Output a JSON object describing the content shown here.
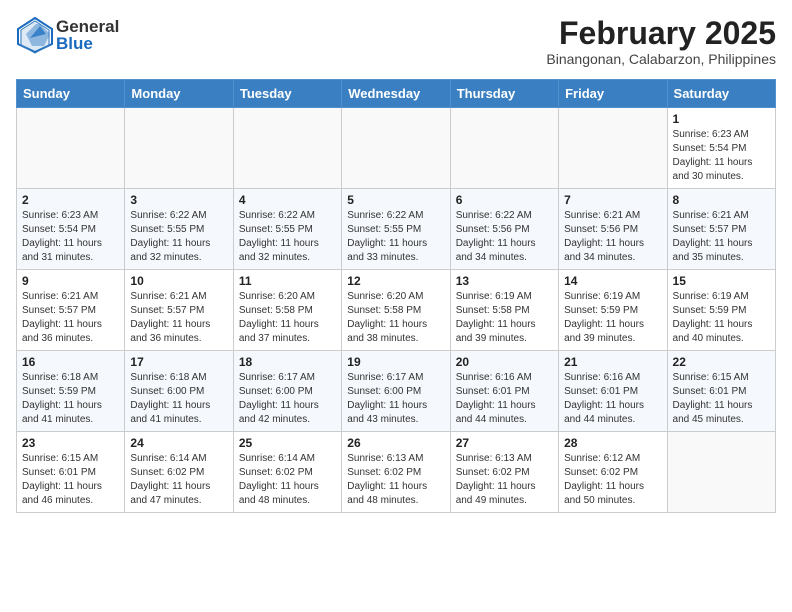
{
  "header": {
    "logo_general": "General",
    "logo_blue": "Blue",
    "title": "February 2025",
    "subtitle": "Binangonan, Calabarzon, Philippines"
  },
  "calendar": {
    "days_of_week": [
      "Sunday",
      "Monday",
      "Tuesday",
      "Wednesday",
      "Thursday",
      "Friday",
      "Saturday"
    ],
    "weeks": [
      [
        {
          "day": "",
          "info": ""
        },
        {
          "day": "",
          "info": ""
        },
        {
          "day": "",
          "info": ""
        },
        {
          "day": "",
          "info": ""
        },
        {
          "day": "",
          "info": ""
        },
        {
          "day": "",
          "info": ""
        },
        {
          "day": "1",
          "info": "Sunrise: 6:23 AM\nSunset: 5:54 PM\nDaylight: 11 hours\nand 30 minutes."
        }
      ],
      [
        {
          "day": "2",
          "info": "Sunrise: 6:23 AM\nSunset: 5:54 PM\nDaylight: 11 hours\nand 31 minutes."
        },
        {
          "day": "3",
          "info": "Sunrise: 6:22 AM\nSunset: 5:55 PM\nDaylight: 11 hours\nand 32 minutes."
        },
        {
          "day": "4",
          "info": "Sunrise: 6:22 AM\nSunset: 5:55 PM\nDaylight: 11 hours\nand 32 minutes."
        },
        {
          "day": "5",
          "info": "Sunrise: 6:22 AM\nSunset: 5:55 PM\nDaylight: 11 hours\nand 33 minutes."
        },
        {
          "day": "6",
          "info": "Sunrise: 6:22 AM\nSunset: 5:56 PM\nDaylight: 11 hours\nand 34 minutes."
        },
        {
          "day": "7",
          "info": "Sunrise: 6:21 AM\nSunset: 5:56 PM\nDaylight: 11 hours\nand 34 minutes."
        },
        {
          "day": "8",
          "info": "Sunrise: 6:21 AM\nSunset: 5:57 PM\nDaylight: 11 hours\nand 35 minutes."
        }
      ],
      [
        {
          "day": "9",
          "info": "Sunrise: 6:21 AM\nSunset: 5:57 PM\nDaylight: 11 hours\nand 36 minutes."
        },
        {
          "day": "10",
          "info": "Sunrise: 6:21 AM\nSunset: 5:57 PM\nDaylight: 11 hours\nand 36 minutes."
        },
        {
          "day": "11",
          "info": "Sunrise: 6:20 AM\nSunset: 5:58 PM\nDaylight: 11 hours\nand 37 minutes."
        },
        {
          "day": "12",
          "info": "Sunrise: 6:20 AM\nSunset: 5:58 PM\nDaylight: 11 hours\nand 38 minutes."
        },
        {
          "day": "13",
          "info": "Sunrise: 6:19 AM\nSunset: 5:58 PM\nDaylight: 11 hours\nand 39 minutes."
        },
        {
          "day": "14",
          "info": "Sunrise: 6:19 AM\nSunset: 5:59 PM\nDaylight: 11 hours\nand 39 minutes."
        },
        {
          "day": "15",
          "info": "Sunrise: 6:19 AM\nSunset: 5:59 PM\nDaylight: 11 hours\nand 40 minutes."
        }
      ],
      [
        {
          "day": "16",
          "info": "Sunrise: 6:18 AM\nSunset: 5:59 PM\nDaylight: 11 hours\nand 41 minutes."
        },
        {
          "day": "17",
          "info": "Sunrise: 6:18 AM\nSunset: 6:00 PM\nDaylight: 11 hours\nand 41 minutes."
        },
        {
          "day": "18",
          "info": "Sunrise: 6:17 AM\nSunset: 6:00 PM\nDaylight: 11 hours\nand 42 minutes."
        },
        {
          "day": "19",
          "info": "Sunrise: 6:17 AM\nSunset: 6:00 PM\nDaylight: 11 hours\nand 43 minutes."
        },
        {
          "day": "20",
          "info": "Sunrise: 6:16 AM\nSunset: 6:01 PM\nDaylight: 11 hours\nand 44 minutes."
        },
        {
          "day": "21",
          "info": "Sunrise: 6:16 AM\nSunset: 6:01 PM\nDaylight: 11 hours\nand 44 minutes."
        },
        {
          "day": "22",
          "info": "Sunrise: 6:15 AM\nSunset: 6:01 PM\nDaylight: 11 hours\nand 45 minutes."
        }
      ],
      [
        {
          "day": "23",
          "info": "Sunrise: 6:15 AM\nSunset: 6:01 PM\nDaylight: 11 hours\nand 46 minutes."
        },
        {
          "day": "24",
          "info": "Sunrise: 6:14 AM\nSunset: 6:02 PM\nDaylight: 11 hours\nand 47 minutes."
        },
        {
          "day": "25",
          "info": "Sunrise: 6:14 AM\nSunset: 6:02 PM\nDaylight: 11 hours\nand 48 minutes."
        },
        {
          "day": "26",
          "info": "Sunrise: 6:13 AM\nSunset: 6:02 PM\nDaylight: 11 hours\nand 48 minutes."
        },
        {
          "day": "27",
          "info": "Sunrise: 6:13 AM\nSunset: 6:02 PM\nDaylight: 11 hours\nand 49 minutes."
        },
        {
          "day": "28",
          "info": "Sunrise: 6:12 AM\nSunset: 6:02 PM\nDaylight: 11 hours\nand 50 minutes."
        },
        {
          "day": "",
          "info": ""
        }
      ]
    ]
  }
}
